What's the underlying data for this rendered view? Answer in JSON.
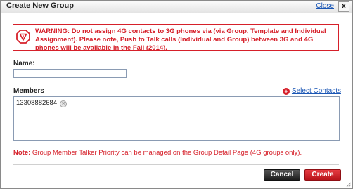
{
  "dialog": {
    "title": "Create New Group",
    "close_link": "Close",
    "close_box": "X"
  },
  "warning": {
    "text": "WARNING: Do not assign 4G contacts to 3G phones via (via Group, Template and Individual Assignment). Please note, Push to Talk calls (Individual and Group) between 3G and 4G phones will be available in the Fall (2014)."
  },
  "form": {
    "name_label": "Name:",
    "name_value": "",
    "members_label": "Members",
    "select_contacts": "Select Contacts",
    "members": [
      "13308882684"
    ]
  },
  "note": {
    "prefix": "Note:",
    "text": " Group Member Talker Priority can be managed on the Group Detail Page (4G groups only)."
  },
  "buttons": {
    "cancel": "Cancel",
    "create": "Create"
  },
  "colors": {
    "accent_red": "#d6202a",
    "link_blue": "#1a56b5"
  }
}
